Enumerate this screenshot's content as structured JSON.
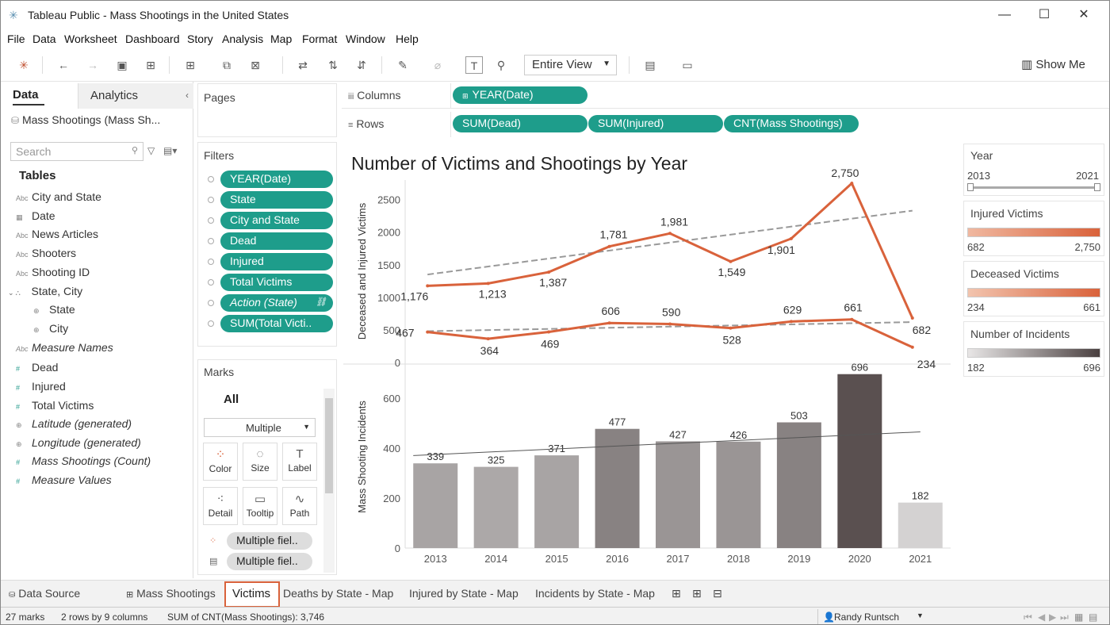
{
  "window": {
    "title": "Tableau Public - Mass Shootings in the United States",
    "min": "—",
    "max": "☐",
    "close": "✕"
  },
  "menu": [
    "File",
    "Data",
    "Worksheet",
    "Dashboard",
    "Story",
    "Analysis",
    "Map",
    "Format",
    "Window",
    "Help"
  ],
  "toolbar": {
    "view_select": "Entire View",
    "show_me": "Show Me"
  },
  "data_pane": {
    "tab_data": "Data",
    "tab_analytics": "Analytics",
    "datasource": "Mass Shootings (Mass Sh...",
    "search_placeholder": "Search",
    "tables_header": "Tables",
    "fields": [
      {
        "icon": "Abc",
        "label": "City and State"
      },
      {
        "icon": "▦",
        "label": "Date"
      },
      {
        "icon": "Abc",
        "label": "News Articles"
      },
      {
        "icon": "Abc",
        "label": "Shooters"
      },
      {
        "icon": "Abc",
        "label": "Shooting ID"
      },
      {
        "icon": "⛬",
        "label": "State, City"
      },
      {
        "icon": "⊕",
        "label": "State"
      },
      {
        "icon": "⊕",
        "label": "City"
      },
      {
        "icon": "Abc",
        "label": "Measure Names"
      },
      {
        "icon": "#",
        "label": "Dead"
      },
      {
        "icon": "#",
        "label": "Injured"
      },
      {
        "icon": "#",
        "label": "Total Victims"
      },
      {
        "icon": "⊕",
        "label": "Latitude (generated)"
      },
      {
        "icon": "⊕",
        "label": "Longitude (generated)"
      },
      {
        "icon": "#",
        "label": "Mass Shootings (Count)"
      },
      {
        "icon": "#",
        "label": "Measure Values"
      }
    ]
  },
  "pages": {
    "title": "Pages"
  },
  "filters": {
    "title": "Filters",
    "items": [
      "YEAR(Date)",
      "State",
      "City and State",
      "Dead",
      "Injured",
      "Total Victims",
      "Action (State)",
      "SUM(Total Victi.."
    ]
  },
  "marks": {
    "title": "Marks",
    "all": "All",
    "type": "Multiple",
    "buttons": [
      "Color",
      "Size",
      "Label",
      "Detail",
      "Tooltip",
      "Path"
    ],
    "fields": [
      "Multiple fiel..",
      "Multiple fiel.."
    ]
  },
  "shelves": {
    "columns_label": "Columns",
    "rows_label": "Rows",
    "columns": [
      "YEAR(Date)"
    ],
    "rows": [
      "SUM(Dead)",
      "SUM(Injured)",
      "CNT(Mass Shootings)"
    ]
  },
  "legends": {
    "year": {
      "title": "Year",
      "min": "2013",
      "max": "2021"
    },
    "injured": {
      "title": "Injured Victims",
      "min": "682",
      "max": "2,750",
      "color": "#d9623b"
    },
    "deceased": {
      "title": "Deceased Victims",
      "min": "234",
      "max": "661",
      "color": "#d9623b"
    },
    "incidents": {
      "title": "Number of Incidents",
      "min": "182",
      "max": "696",
      "color": "#4a4040"
    }
  },
  "chart_data": {
    "type": "line",
    "title": "Number of Victims and Shootings by Year",
    "categories": [
      "2013",
      "2014",
      "2015",
      "2016",
      "2017",
      "2018",
      "2019",
      "2020",
      "2021"
    ],
    "top": {
      "ylabel": "Deceased and Injured Victims",
      "ylim": [
        0,
        2800
      ],
      "yticks": [
        "0",
        "500",
        "1000",
        "1500",
        "2000",
        "2500"
      ],
      "series": [
        {
          "name": "Injured",
          "values": [
            1176,
            1213,
            1387,
            1781,
            1981,
            1549,
            1901,
            2750,
            682
          ],
          "labels": [
            "1,176",
            "1,213",
            "1,387",
            "1,781",
            "1,981",
            "1,549",
            "1,901",
            "2,750",
            "682"
          ],
          "trend": [
            1350,
            2330
          ]
        },
        {
          "name": "Dead",
          "values": [
            467,
            364,
            469,
            606,
            590,
            528,
            629,
            661,
            234
          ],
          "labels": [
            "467",
            "364",
            "469",
            "606",
            "590",
            "528",
            "629",
            "661",
            "234"
          ],
          "trend": [
            480,
            620
          ]
        }
      ]
    },
    "bottom": {
      "type": "bar",
      "ylabel": "Mass Shooting Incidents",
      "ylim": [
        0,
        730
      ],
      "yticks": [
        "0",
        "200",
        "400",
        "600"
      ],
      "values": [
        339,
        325,
        371,
        477,
        427,
        426,
        503,
        696,
        182
      ],
      "labels": [
        "339",
        "325",
        "371",
        "477",
        "427",
        "426",
        "503",
        "696",
        "182"
      ],
      "trend": [
        370,
        465
      ]
    }
  },
  "sheet_tabs": {
    "items": [
      "Data Source",
      "Mass Shootings",
      "Victims",
      "Deaths by State - Map",
      "Injured by State - Map",
      "Incidents by State - Map"
    ],
    "active": "Victims"
  },
  "status": {
    "marks": "27 marks",
    "grid": "2 rows by 9 columns",
    "sum": "SUM of CNT(Mass Shootings): 3,746",
    "user": "Randy Runtsch"
  }
}
